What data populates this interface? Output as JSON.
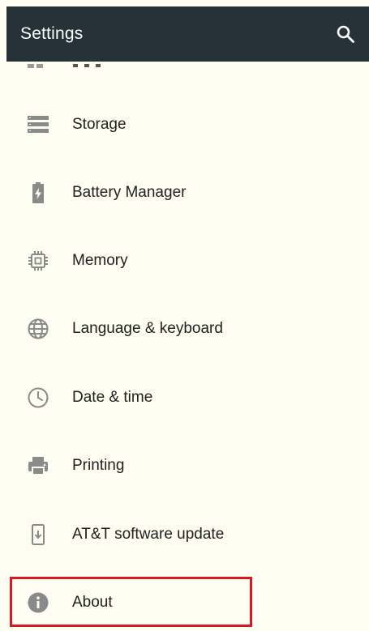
{
  "toolbar": {
    "title": "Settings",
    "search_icon": "search-icon"
  },
  "menu": {
    "items": [
      {
        "label": "Storage",
        "icon": "storage-icon"
      },
      {
        "label": "Battery Manager",
        "icon": "battery-icon"
      },
      {
        "label": "Memory",
        "icon": "memory-chip-icon"
      },
      {
        "label": "Language & keyboard",
        "icon": "globe-icon"
      },
      {
        "label": "Date & time",
        "icon": "clock-icon"
      },
      {
        "label": "Printing",
        "icon": "printer-icon"
      },
      {
        "label": "AT&T software update",
        "icon": "system-update-icon"
      },
      {
        "label": "About",
        "icon": "info-icon"
      }
    ],
    "highlighted_item": "About",
    "highlight_color": "#d71920"
  },
  "colors": {
    "toolbar_background": "#263238",
    "list_background": "#fdfdf1",
    "icon_gray": "#8a8a8a",
    "text_primary": "#212121"
  }
}
